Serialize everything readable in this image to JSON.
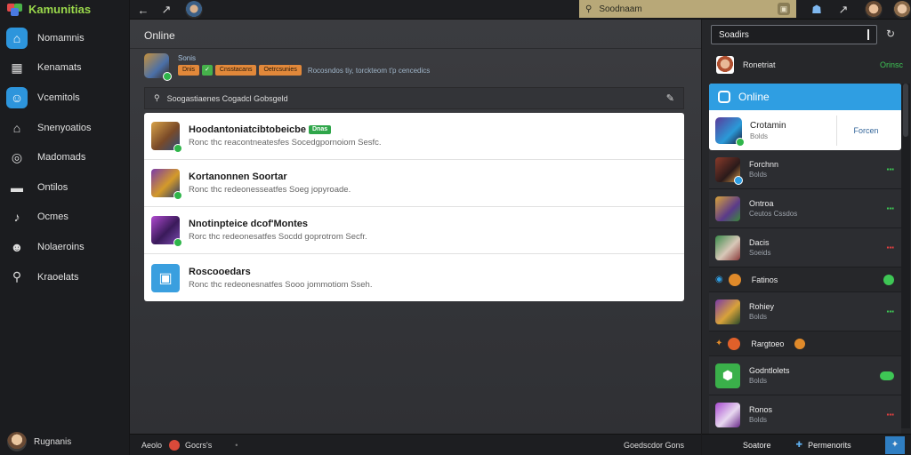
{
  "app": {
    "title": "Kamunitias"
  },
  "sidebar": {
    "items": [
      {
        "label": "Nomamnis",
        "icon": "home-icon",
        "active": true
      },
      {
        "label": "Kenamats",
        "icon": "grid-icon",
        "active": false
      },
      {
        "label": "Vcemitols",
        "icon": "face-icon",
        "active": true
      },
      {
        "label": "Snenyoatios",
        "icon": "store-icon",
        "active": false
      },
      {
        "label": "Madomads",
        "icon": "target-icon",
        "active": false
      },
      {
        "label": "Ontilos",
        "icon": "window-icon",
        "active": false
      },
      {
        "label": "Ocmes",
        "icon": "music-icon",
        "active": false
      },
      {
        "label": "Nolaeroins",
        "icon": "smile-icon",
        "active": false
      },
      {
        "label": "Kraoelats",
        "icon": "search-icon",
        "active": false
      }
    ],
    "user_label": "Rugnanis"
  },
  "topbar": {
    "search_placeholder": "Soodnaam"
  },
  "main": {
    "title": "Online",
    "notification": {
      "heading": "Sonis",
      "pills": [
        "Dnis",
        "Cnsstacans",
        "Oetrcsunies"
      ],
      "text": "Rocosndos tiy, torckteom t'p cencedics"
    },
    "search_panel": {
      "label": "Soogastiaenes Cogadcl Gobsgeld"
    },
    "list": [
      {
        "title": "Hoodantoniatcibtobeicbe",
        "tag": "Dnas",
        "sub": "Ronc thc reacontneatesfes Socedgpornoiom Sesfc."
      },
      {
        "title": "Kortanonnen Soortar",
        "tag": "",
        "sub": "Ronc thc redeonesseatfes Soeg jopyroade."
      },
      {
        "title": "Nnotinpteice dcof'Montes",
        "tag": "",
        "sub": "Rorc thc redeonesatfes Socdd goprotrom Secfr."
      },
      {
        "title": "Roscooedars",
        "tag": "",
        "sub": "Ronc thc redeonesnatfes Sooo jommotiom Sseh."
      }
    ]
  },
  "bottombar": {
    "left_a": "Aeolo",
    "left_b": "Gocrs's",
    "right": "Goedscdor Gons"
  },
  "right_panel": {
    "search_value": "Soadirs",
    "top_user": {
      "name": "Ronetriat",
      "status": "Orinsc"
    },
    "online_card": {
      "header": "Online",
      "name": "Crotamin",
      "sub": "Bolds",
      "button": "Forcen"
    },
    "friends": [
      {
        "type": "row",
        "name": "Forchnn",
        "sub": "Bolds",
        "status": "green"
      },
      {
        "type": "row",
        "name": "Ontroa",
        "sub": "Ceutos Cssdos",
        "status": "green"
      },
      {
        "type": "row",
        "name": "Dacis",
        "sub": "Soeids",
        "status": "red"
      },
      {
        "type": "section",
        "name": "Fatinos",
        "status": "green"
      },
      {
        "type": "row",
        "name": "Rohiey",
        "sub": "Bolds",
        "status": "green"
      },
      {
        "type": "section",
        "name": "Rargtoeo",
        "status": "orange"
      },
      {
        "type": "row",
        "name": "Godntlolets",
        "sub": "Bolds",
        "status": "green"
      },
      {
        "type": "row",
        "name": "Ronos",
        "sub": "Bolds",
        "status": "red"
      }
    ],
    "bottom_left": "Soatore",
    "bottom_right": "Permenorits"
  },
  "colors": {
    "accent": "#2f9ee2",
    "online": "#3ec655",
    "busy": "#e04040",
    "away": "#e08a2a"
  }
}
